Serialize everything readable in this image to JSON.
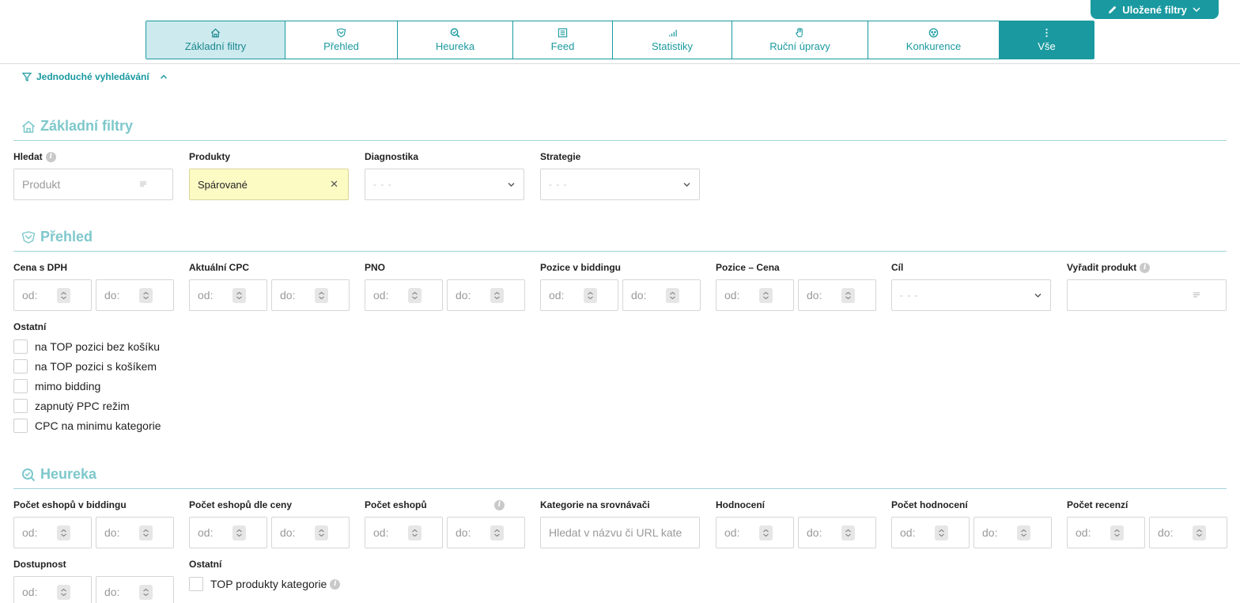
{
  "header": {
    "saved_filters_label": "Uložené filtry",
    "tabs": [
      {
        "label": "Základní filtry",
        "icon": "home-icon"
      },
      {
        "label": "Přehled",
        "icon": "shield-icon"
      },
      {
        "label": "Heureka",
        "icon": "search-check-icon"
      },
      {
        "label": "Feed",
        "icon": "list-icon"
      },
      {
        "label": "Statistiky",
        "icon": "bar-chart-icon"
      },
      {
        "label": "Ruční úpravy",
        "icon": "hand-icon"
      },
      {
        "label": "Konkurence",
        "icon": "group-icon"
      },
      {
        "label": "Vše",
        "icon": "kebab-icon"
      }
    ],
    "active_tab": "Základní filtry"
  },
  "simple_search_label": "Jednoduché vyhledávání",
  "basic": {
    "title": "Základní filtry",
    "search_label": "Hledat",
    "search_placeholder": "Produkt",
    "products_label": "Produkty",
    "products_value": "Spárované",
    "diagnostics_label": "Diagnostika",
    "diagnostics_value": "- - -",
    "strategy_label": "Strategie",
    "strategy_value": "- - -"
  },
  "overview": {
    "title": "Přehled",
    "price_label": "Cena s DPH",
    "cpc_label": "Aktuální CPC",
    "pno_label": "PNO",
    "bidding_pos_label": "Pozice v biddingu",
    "pos_price_label": "Pozice – Cena",
    "goal_label": "Cíl",
    "goal_value": "- - -",
    "exclude_label": "Vyřadit produkt",
    "other_label": "Ostatní",
    "checkboxes": [
      "na TOP pozici bez košíku",
      "na TOP pozici s košíkem",
      "mimo bidding",
      "zapnutý PPC režim",
      "CPC na minimu kategorie"
    ]
  },
  "heureka": {
    "title": "Heureka",
    "shops_bidding_label": "Počet eshopů v biddingu",
    "shops_price_label": "Počet eshopů dle ceny",
    "shops_label": "Počet eshopů",
    "category_label": "Kategorie na srovnávači",
    "category_placeholder": "Hledat v názvu či URL kate",
    "rating_label": "Hodnocení",
    "rating_count_label": "Počet hodnocení",
    "reviews_label": "Počet recenzí",
    "availability_label": "Dostupnost",
    "other_label": "Ostatní",
    "top_products_label": "TOP produkty kategorie"
  },
  "range": {
    "from": "od:",
    "to": "do:"
  },
  "colors": {
    "accent": "#1a9aa0",
    "section_title": "#7ec8cc",
    "active_tab_bg": "#cdeaee",
    "selected_value_bg": "#fdfbc4"
  }
}
